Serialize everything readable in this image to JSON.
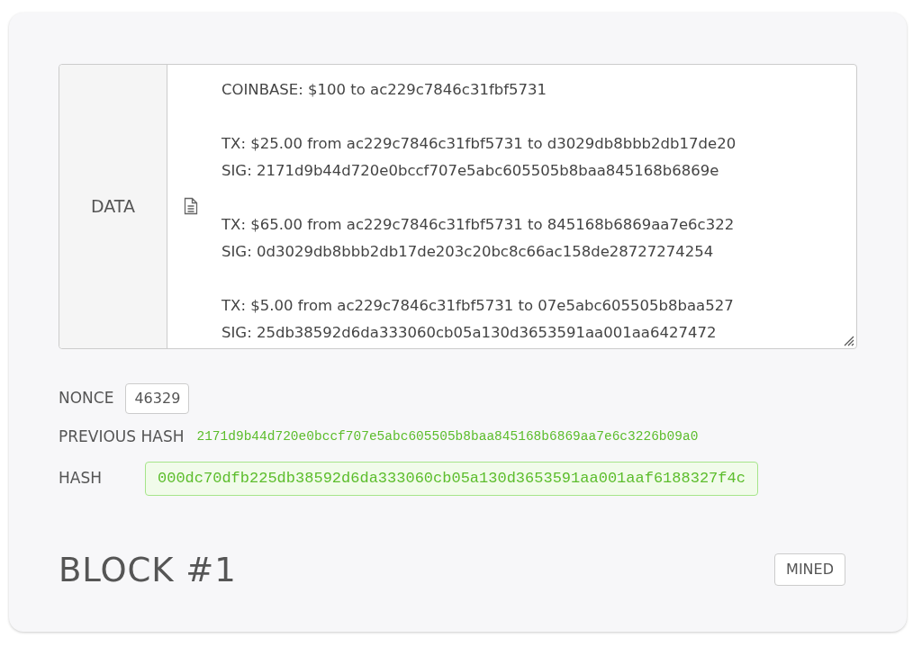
{
  "data_field": {
    "label": "DATA",
    "entries": [
      {
        "lines": [
          "COINBASE: $100 to ac229c7846c31fbf5731"
        ]
      },
      {
        "lines": [
          "TX: $25.00 from ac229c7846c31fbf5731 to d3029db8bbb2db17de20",
          "SIG: 2171d9b44d720e0bccf707e5abc605505b8baa845168b6869e"
        ]
      },
      {
        "lines": [
          "TX: $65.00 from ac229c7846c31fbf5731 to 845168b6869aa7e6c322",
          "SIG: 0d3029db8bbb2db17de203c20bc8c66ac158de28727274254"
        ]
      },
      {
        "lines": [
          "TX: $5.00 from ac229c7846c31fbf5731 to 07e5abc605505b8baa527",
          "SIG: 25db38592d6da333060cb05a130d3653591aa001aa6427472"
        ]
      }
    ]
  },
  "nonce": {
    "label": "NONCE",
    "value": "46329"
  },
  "previous_hash": {
    "label": "PREVIOUS HASH",
    "value": "2171d9b44d720e0bccf707e5abc605505b8baa845168b6869aa7e6c3226b09a0"
  },
  "hash": {
    "label": "HASH",
    "value": "000dc70dfb225db38592d6da333060cb05a130d3653591aa001aaf6188327f4c",
    "valid": true
  },
  "block": {
    "title": "BLOCK #1",
    "button": "MINED"
  }
}
